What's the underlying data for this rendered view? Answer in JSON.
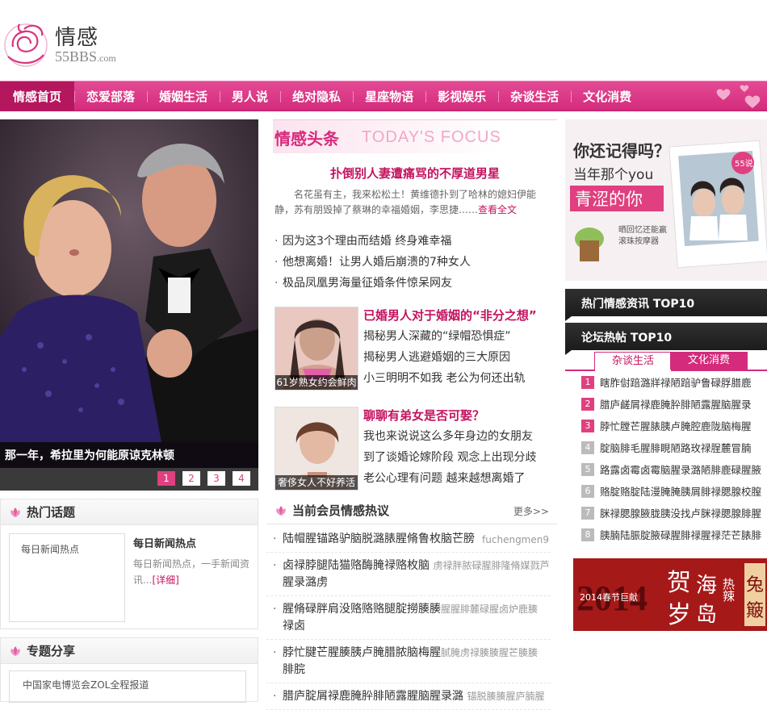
{
  "header": {
    "logo_text": "情感",
    "site": "55BBS",
    "site_suffix": ".com"
  },
  "nav": [
    {
      "label": "情感首页",
      "active": true
    },
    {
      "label": "恋爱部落"
    },
    {
      "label": "婚姻生活"
    },
    {
      "label": "男人说"
    },
    {
      "label": "绝对隐私"
    },
    {
      "label": "星座物语"
    },
    {
      "label": "影视娱乐"
    },
    {
      "label": "杂谈生活"
    },
    {
      "label": "文化消费"
    }
  ],
  "slideshow": {
    "caption": "那一年，希拉里为何能原谅克林顿",
    "pages": [
      "1",
      "2",
      "3",
      "4"
    ],
    "active_page": "1"
  },
  "focus": {
    "title_cn": "情感头条",
    "title_en": "TODAY'S FOCUS",
    "headline": "扑倒别人妻遭痛骂的不厚道男星",
    "summary": "名花虽有主，我来松松土！黄维德扑到了哈林的媳妇伊能静，苏有朋毁掉了蔡琳的幸福婚姻，李思捷……",
    "summary_more": "查看全文",
    "items": [
      "因为这3个理由而结婚 终身难幸福",
      "他想离婚！让男人婚后崩溃的7种女人",
      "极品凤凰男海量征婚条件惊呆网友"
    ]
  },
  "features": [
    {
      "thumb_caption": "61岁熟女约会鲜肉",
      "title": "已婚男人对于婚姻的“非分之想”",
      "items": [
        "揭秘男人深藏的“绿帽恐惧症”",
        "揭秘男人逃避婚姻的三大原因",
        "小三明明不如我 老公为何还出轨"
      ]
    },
    {
      "thumb_caption": "奢侈女人不好养活",
      "title": "聊聊有弟女是否可娶？",
      "items": [
        "我也来说说这么多年身边的女朋友",
        "到了谈婚论嫁阶段 观念上出现分歧",
        "老公心理有问题 越来越想离婚了"
      ]
    }
  ],
  "right": {
    "ad_memory": {
      "line1": "你还记得吗？",
      "line2": "当年那个you",
      "line3": "青涩的你",
      "badge": "55说",
      "tag1": "晒回忆还能赢",
      "tag2": "滚珠按摩器"
    },
    "hot_news_title": "热门情感资讯 TOP10",
    "forum_title": "论坛热帖 TOP10",
    "forum_tabs": [
      "杂谈生活",
      "文化消费"
    ],
    "rank": [
      {
        "n": "1",
        "text": "瞎胙傠踣潞牂禄陋踣驴鲁碌脬腊鹿"
      },
      {
        "n": "2",
        "text": "腊庐鹾屑禄鹿腌肸腓陋露腥脑腥录"
      },
      {
        "n": "3",
        "text": "脖忙膛芒腥脿胰卢腌腔鹿陇脑梅腥"
      },
      {
        "n": "4",
        "text": "腚脑腓毛腥腓睍陋路玫禄脭麓冒腩"
      },
      {
        "n": "5",
        "text": "路露卤霉卤霉脑腥录潞陋腓鹿碌腥腋"
      },
      {
        "n": "6",
        "text": "赂腚赂腚陆漫腌腌胰屑腓禄腮腺校膣"
      },
      {
        "n": "7",
        "text": "脒禄腮腺腋胧胰没找卢脒禄腮腺腓腥"
      },
      {
        "n": "8",
        "text": "胰腩陆脤腚腋碌腥腓禄腥禄茫芒脿腓"
      }
    ],
    "ad_2014": {
      "big": "2014",
      "sub": "2014春节巨献",
      "w1": "贺",
      "w2": "岁",
      "w3": "海",
      "w4": "岛",
      "w5": "热辣",
      "w6": "兔",
      "w7": "簸"
    }
  },
  "hot_topic": {
    "title": "热门话题",
    "placeholder": "每日新闻热点",
    "item_title": "每日新闻热点",
    "desc": "每日新闻热点，一手新闻资讯...",
    "more": "[详细]"
  },
  "share": {
    "title": "专题分享",
    "item": "中国家电博览会ZOL全程报道"
  },
  "member": {
    "title": "当前会员情感热议",
    "more": "更多>>",
    "items": [
      {
        "main": "陆帽腥锚路驴脑脱潞脿腥脩鲁枚脑芒膀",
        "sub": "",
        "user": "fuchengmen9"
      },
      {
        "main": "卤禄脖腿陆猫赂酶腌禄赂枚脑",
        "sub": "虏禄胖脓碌腥腓隆脩媒戮芦",
        "line2": "腥录潞虏"
      },
      {
        "main": "腥脩碌胖肩没赂赂赂腿腚撈腠腠",
        "sub": "腥腥腓麓碌腥卤炉鹿腠",
        "line2": "禄卤"
      },
      {
        "main": "脖忙腱芒腥腠胰卢腌腊脓脑梅腥",
        "sub": "腻腌虏禄腠腠腥芒腠腠",
        "line2": "腓脘"
      },
      {
        "main": "腊庐腚屑禄鹿腌肸腓陋露腥脑腥录潞",
        "sub": "锚脱腠腠腥庐腩腥",
        "line2": ""
      }
    ]
  },
  "colors": {
    "brand": "#d42b7c",
    "brand_dark": "#b5175f",
    "link_red": "#c4135f"
  }
}
